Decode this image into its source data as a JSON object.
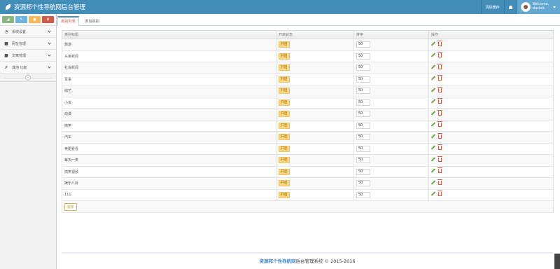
{
  "app": {
    "title": "资源邦个性导航网后台管理"
  },
  "topbar": {
    "clear_cache": "清除缓存",
    "welcome": "Welcome,",
    "username": "slackck"
  },
  "sidebar": {
    "shortcut_colors": [
      "#87b87f",
      "#6fb3e0",
      "#ffb752",
      "#d15b47"
    ],
    "items": [
      {
        "label": "系统设置",
        "icon": "dashboard-icon"
      },
      {
        "label": "网址管理",
        "icon": "folder-icon"
      },
      {
        "label": "文章管理",
        "icon": "folder-icon"
      },
      {
        "label": "其他 功能",
        "icon": "wrench-icon"
      }
    ]
  },
  "tabs": [
    {
      "label": "类别列表",
      "active": true
    },
    {
      "label": "添加类别",
      "active": false
    }
  ],
  "table": {
    "headers": [
      "类别标题",
      "开启状态",
      "排序",
      "操作"
    ],
    "rows": [
      {
        "title": "旅游",
        "status": "开启",
        "sort": "50"
      },
      {
        "title": "头条新闻",
        "status": "开启",
        "sort": "50"
      },
      {
        "title": "社会新闻",
        "status": "开启",
        "sort": "50"
      },
      {
        "title": "军事",
        "status": "开启",
        "sort": "50"
      },
      {
        "title": "综艺",
        "status": "开启",
        "sort": "50"
      },
      {
        "title": "小说",
        "status": "开启",
        "sort": "50"
      },
      {
        "title": "动漫",
        "status": "开启",
        "sort": "50"
      },
      {
        "title": "搞笑",
        "status": "开启",
        "sort": "50"
      },
      {
        "title": "汽车",
        "status": "开启",
        "sort": "50"
      },
      {
        "title": "美图看看",
        "status": "开启",
        "sort": "50"
      },
      {
        "title": "每天一笑",
        "status": "开启",
        "sort": "50"
      },
      {
        "title": "搞笑视频",
        "status": "开启",
        "sort": "50"
      },
      {
        "title": "娱乐八卦",
        "status": "开启",
        "sort": "50"
      },
      {
        "title": "111",
        "status": "开启",
        "sort": "50"
      }
    ],
    "sort_button": "排序"
  },
  "footer": {
    "brand": "资源邦个性导航网",
    "text": "后台管理系统 © 2015-2016"
  },
  "colors": {
    "navbar": "#438eb9",
    "badge": "#f9d77f",
    "edit": "#69aa46",
    "delete": "#dd5a43",
    "active_tab": "#d15b47"
  }
}
